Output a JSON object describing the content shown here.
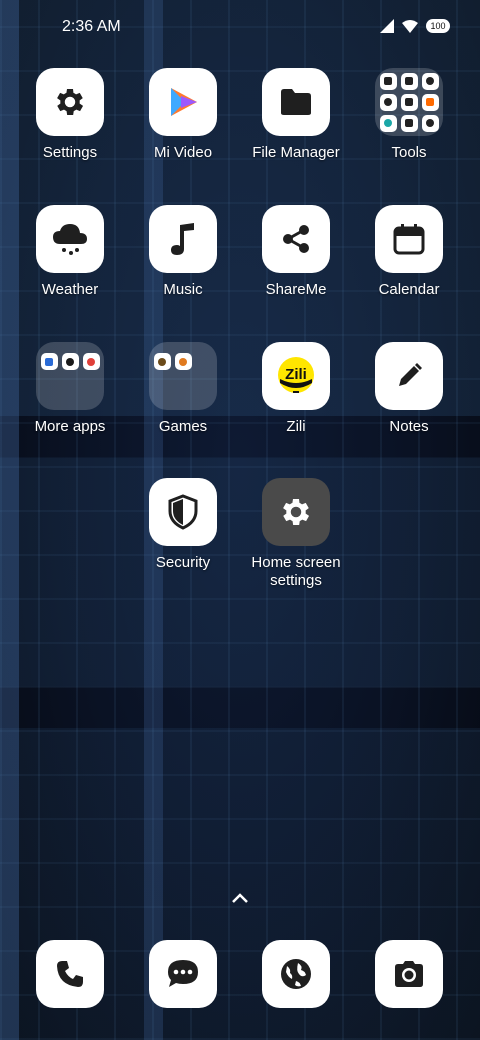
{
  "status_bar": {
    "time": "2:36 AM",
    "battery": "100",
    "icons": [
      "signal-icon",
      "wifi-icon",
      "battery-icon"
    ]
  },
  "apps": {
    "settings": "Settings",
    "mi_video": "Mi Video",
    "file_manager": "File Manager",
    "tools": "Tools",
    "weather": "Weather",
    "music": "Music",
    "shareme": "ShareMe",
    "calendar": "Calendar",
    "more_apps": "More apps",
    "games": "Games",
    "zili": "Zili",
    "notes": "Notes",
    "security": "Security",
    "home_screen_settings": "Home screen settings"
  },
  "zili_logo_text": "Zili",
  "dock": {
    "items": [
      "phone-icon",
      "messaging-icon",
      "browser-icon",
      "camera-icon"
    ]
  },
  "colors": {
    "tile_bg": "#ffffff",
    "icon_dark": "#1f1f1f",
    "zili_yellow": "#ffe600"
  }
}
